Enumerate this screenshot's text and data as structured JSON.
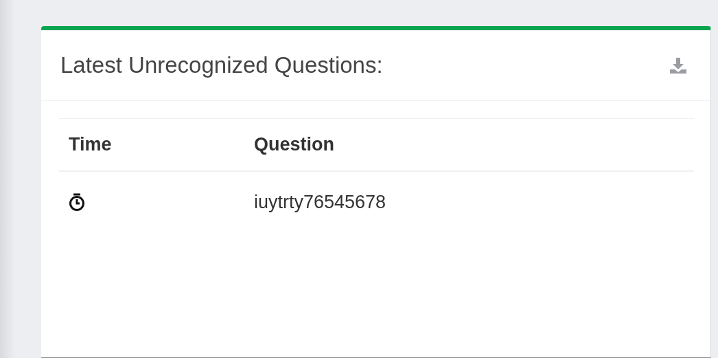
{
  "panel": {
    "title": "Latest Unrecognized Questions:",
    "table": {
      "columns": [
        "Time",
        "Question"
      ],
      "rows": [
        {
          "question": "iuytrty76545678"
        }
      ]
    }
  }
}
